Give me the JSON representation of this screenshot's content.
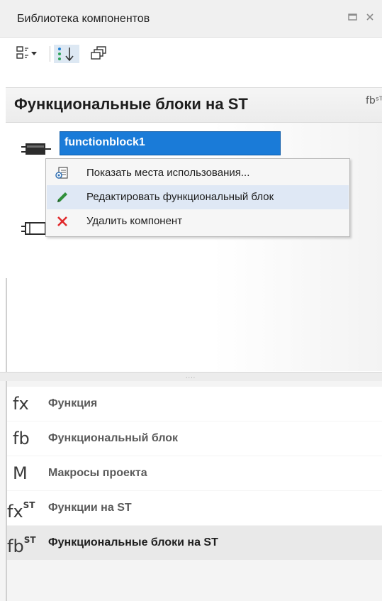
{
  "panel": {
    "title": "Библиотека компонентов",
    "buttons": [
      "maximize-icon",
      "close-icon"
    ]
  },
  "toolbar": {
    "tools": [
      {
        "icon": "view-mode-dropdown-icon"
      },
      {
        "icon": "sort-icon",
        "active": true
      },
      {
        "icon": "stack-view-icon"
      }
    ]
  },
  "section": {
    "title": "Функциональные блоки на ST",
    "header_icon": "fbˢᵀ"
  },
  "components": [
    {
      "name": "functionblock1",
      "selected": true,
      "editing": true
    },
    {
      "name": "",
      "selected": false
    }
  ],
  "context_menu": {
    "items": [
      {
        "label": "Показать места использования...",
        "icon": "usage-icon",
        "highlighted": false
      },
      {
        "label": "Редактировать функциональный блок",
        "icon": "pencil-icon",
        "highlighted": true
      },
      {
        "label": "Удалить компонент",
        "icon": "delete-x-icon",
        "highlighted": false
      }
    ]
  },
  "splitter": {
    "grip": "····"
  },
  "categories": [
    {
      "icon_main": "fx",
      "icon_sup": "",
      "label": "Функция",
      "selected": false
    },
    {
      "icon_main": "fb",
      "icon_sup": "",
      "label": "Функциональный блок",
      "selected": false
    },
    {
      "icon_main": "M",
      "icon_sup": "",
      "label": "Макросы проекта",
      "selected": false
    },
    {
      "icon_main": "fx",
      "icon_sup": "ST",
      "label": "Функции на ST",
      "selected": false
    },
    {
      "icon_main": "fb",
      "icon_sup": "ST",
      "label": "Функциональные блоки на ST",
      "selected": true
    }
  ],
  "colors": {
    "selection_blue": "#1a7bd8",
    "menu_highlight": "#dfe8f5",
    "delete_red": "#e0282a",
    "pencil_green": "#2f8f3a"
  }
}
